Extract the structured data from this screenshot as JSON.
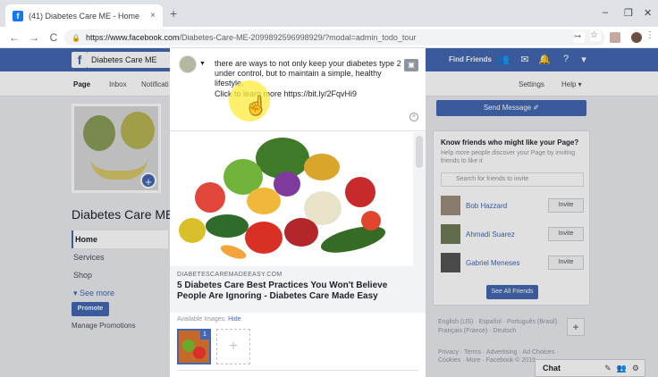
{
  "browser": {
    "tab_title": "(41) Diabetes Care ME - Home",
    "tab_favicon": "f",
    "tab_close": "×",
    "new_tab": "+",
    "url_domain": "https://www.facebook.com",
    "url_path": "/Diabetes-Care-ME-2099892596998929/?modal=admin_todo_tour",
    "win_min": "–",
    "win_max": "❐",
    "win_close": "✕",
    "back": "←",
    "forward": "→",
    "reload": "C"
  },
  "fb": {
    "search_value": "Diabetes Care ME",
    "find_friends": "Find Friends",
    "subnav": {
      "page": "Page",
      "inbox": "Inbox",
      "notifications": "Notificati",
      "settings": "Settings",
      "help": "Help ▾"
    },
    "page_name": "Diabetes Care ME",
    "left_nav": [
      "Home",
      "Services",
      "Shop",
      "▾ See more"
    ],
    "promote": "Promote",
    "manage_promotions": "Manage Promotions",
    "send_message": "Send Message ✐",
    "know_title": "Know friends who might like your Page?",
    "know_sub": "Help more people discover your Page by inviting friends to like it",
    "know_search": "Search for friends to invite",
    "friends": [
      {
        "name": "Bob Hazzard",
        "invite": "Invite"
      },
      {
        "name": "Ahmadi Suarez",
        "invite": "Invite"
      },
      {
        "name": "Gabriel Meneses",
        "invite": "Invite"
      }
    ],
    "see_all": "See All Friends",
    "langs": "English (US) · Español · Português (Brasil) · Français (France) · Deutsch",
    "legal": "Privacy · Terms · Advertising · Ad Choices · Cookies · More · Facebook © 2019",
    "chat": "Chat"
  },
  "modal": {
    "post_text": "there are ways to not only keep your diabetes type 2 under control, but to maintain a simple, healthy lifestyle.",
    "post_link": "Click to learn more https://bit.ly/2FqvHi9",
    "domain": "DIABETESCAREMADEEASY.COM",
    "headline": "5 Diabetes Care Best Practices You Won't Believe People Are Ignoring - Diabetes Care Made Easy",
    "available_images": "Available Images:",
    "hide": "Hide",
    "thumb_count": "1",
    "add": "+"
  },
  "colors": {
    "fb_blue": "#4267b2",
    "highlight": "#ffeb3b"
  }
}
